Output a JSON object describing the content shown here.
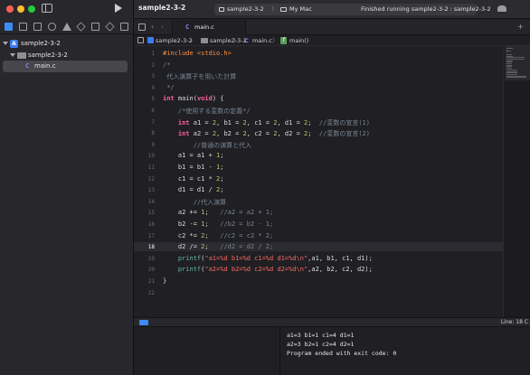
{
  "window": {
    "traffic_lights": [
      "#ff5f57",
      "#febc2e",
      "#28c840"
    ]
  },
  "sidebar": {
    "tree": [
      {
        "label": "sample2-3-2",
        "kind": "project"
      },
      {
        "label": "sample2-3-2",
        "kind": "group"
      },
      {
        "label": "main.c",
        "kind": "file",
        "icon": "C",
        "selected": true
      }
    ]
  },
  "toolbar": {
    "project": "sample2-3-2",
    "scheme": "sample2-3-2",
    "scheme_chevron": "〉",
    "destination": "My Mac",
    "status": "Finished running sample2-3-2 : sample2-3-2"
  },
  "tabs": [
    {
      "label": "main.c",
      "icon": "C"
    }
  ],
  "jumpbar": {
    "items": [
      "sample2-3-2",
      "sample2-3-2",
      "main.c",
      "main()"
    ],
    "chevron": "〉",
    "file_icon": "C",
    "func_icon": "f"
  },
  "editor": {
    "current_line": 18,
    "lines": [
      "#include <stdio.h>",
      "/*",
      " 代入演算子を用いた計算",
      " */",
      "int main(void) {",
      "    /*使用する変数の定義*/",
      "    int a1 = 2, b1 = 2, c1 = 2, d1 = 2;  //変数の宣言(1)",
      "    int a2 = 2, b2 = 2, c2 = 2, d2 = 2;  //変数の宣言(2)",
      "        //普通の演算と代入",
      "    a1 = a1 + 1;",
      "    b1 = b1 - 1;",
      "    c1 = c1 * 2;",
      "    d1 = d1 / 2;",
      "        //代入演算",
      "    a2 += 1;   //a2 = a2 + 1;",
      "    b2 -= 1;   //b2 = b2 - 1;",
      "    c2 *= 2;   //c2 = c2 * 2;",
      "    d2 /= 2;   //d2 = d2 / 2;",
      "    printf(\"a1=%d b1=%d c1=%d d1=%d\\n\",a1, b1, c1, d1);",
      "    printf(\"a2=%d b2=%d c2=%d d2=%d\\n\",a2, b2, c2, d2);",
      "}",
      ""
    ]
  },
  "debug": {
    "line_col": "Line: 18  C"
  },
  "console": {
    "lines": [
      "a1=3 b1=1 c1=4 d1=1",
      "a2=3 b2=1 c2=4 d2=1",
      "Program ended with exit code: 0"
    ]
  }
}
